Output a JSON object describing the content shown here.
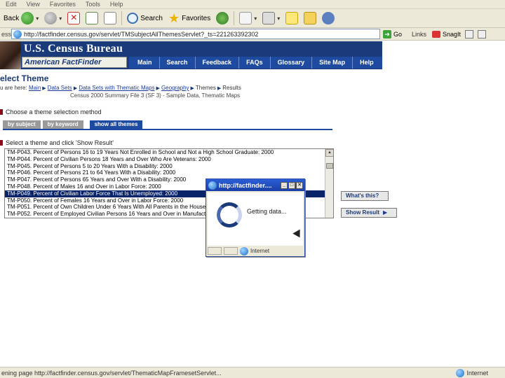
{
  "menubar": {
    "items": [
      "Edit",
      "View",
      "Favorites",
      "Tools",
      "Help"
    ]
  },
  "toolbar": {
    "back_label": "Back",
    "search_label": "Search",
    "favorites_label": "Favorites"
  },
  "address": {
    "label": "ess",
    "url": "http://factfinder.census.gov/servlet/TMSubjectAllThemesServlet?_ts=221263392302",
    "go_label": "Go",
    "links_label": "Links",
    "snagit_label": "SnagIt"
  },
  "banner": {
    "title": "U.S. Census Bureau",
    "subtitle": "American FactFinder",
    "nav": [
      "Main",
      "Search",
      "Feedback",
      "FAQs",
      "Glossary",
      "Site Map",
      "Help"
    ]
  },
  "page": {
    "title": "elect Theme",
    "breadcrumb_prefix": "u are here:",
    "breadcrumb": [
      {
        "label": "Main",
        "link": true
      },
      {
        "label": "Data Sets",
        "link": true
      },
      {
        "label": "Data Sets with Thematic Maps",
        "link": true
      },
      {
        "label": "Geography",
        "link": true
      },
      {
        "label": "Themes",
        "link": false
      },
      {
        "label": "Results",
        "link": false
      }
    ],
    "dataset": "Census 2000 Summary File 3 (SF 3) - Sample Data, Thematic Maps",
    "method_heading": "Choose a theme selection method",
    "tabs": [
      "by subject",
      "by keyword",
      "show all themes"
    ],
    "select_heading": "Select a theme and click 'Show Result'"
  },
  "themes": [
    "TM-P043. Percent of Persons 16 to 19 Years Not Enrolled in School and Not a High School Graduate: 2000",
    "TM-P044. Percent of Civilian Persons 18 Years and Over Who Are Veterans: 2000",
    "TM-P045. Percent of Persons 5 to 20 Years With a Disability: 2000",
    "TM-P046. Percent of Persons 21 to 64 Years With a Disability: 2000",
    "TM-P047. Percent of Persons 65 Years and Over With a Disability: 2000",
    "TM-P048. Percent of Males 16 and Over in Labor Force: 2000",
    "TM-P049. Percent of Civilian Labor Force That Is Unemployed: 2000",
    "TM-P050. Percent of Females 16 Years and Over in Labor Force: 2000",
    "TM-P051. Percent of Own Children Under 6 Years With All Parents in the House",
    "TM-P052. Percent of Employed Civilian Persons 16 Years and Over in Manufactur"
  ],
  "selected_index": 6,
  "buttons": {
    "whats_this": "What's this?",
    "show_result": "Show Result"
  },
  "popup": {
    "title": "http://factfinder....",
    "message": "Getting data...",
    "zone": "Internet"
  },
  "statusbar": {
    "text": "ening page http://factfinder.census.gov/servlet/ThematicMapFramesetServlet...",
    "zone": "Internet"
  }
}
